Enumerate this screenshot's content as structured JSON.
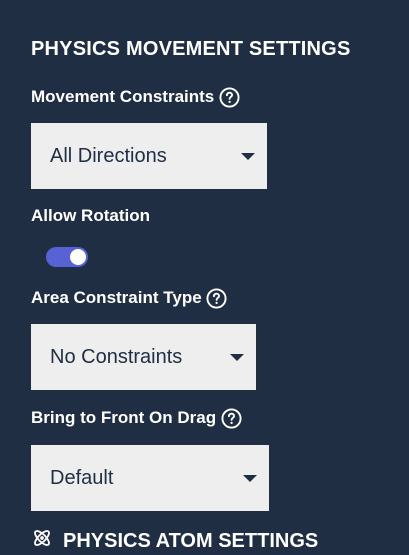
{
  "physics_movement": {
    "title": "PHYSICS MOVEMENT SETTINGS",
    "movement_constraints": {
      "label": "Movement Constraints",
      "value": "All Directions"
    },
    "allow_rotation": {
      "label": "Allow Rotation",
      "enabled": true
    },
    "area_constraint_type": {
      "label": "Area Constraint Type",
      "value": "No Constraints"
    },
    "bring_to_front": {
      "label": "Bring to Front On Drag",
      "value": "Default"
    }
  },
  "physics_atom": {
    "title": "PHYSICS ATOM SETTINGS",
    "icon": "atom-icon"
  },
  "colors": {
    "background": "#1f2e43",
    "dropdown": "#eeeeee",
    "toggle_on": "#5762d5"
  }
}
